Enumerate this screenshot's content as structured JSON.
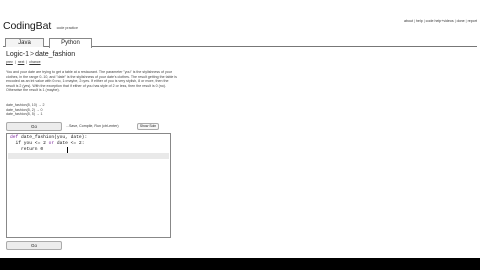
{
  "header": {
    "logo_text": "CodingBat",
    "logo_subtext": "code practice",
    "links": [
      "about",
      "help",
      "code help+videos",
      "done",
      "report"
    ]
  },
  "tabs": [
    {
      "label": "Java",
      "selected": false
    },
    {
      "label": "Python",
      "selected": true
    }
  ],
  "problem": {
    "category": "Logic-1",
    "separator": ">",
    "name": "date_fashion",
    "links": [
      "prev",
      "next",
      "chance"
    ],
    "description": "You and your date are trying to get a table at a restaurant. The parameter \"you\" is the stylishness of your clothes, in the range 0..10, and \"date\" is the stylishness of your date's clothes. The result getting the table is encoded as an int value with 0=no, 1=maybe, 2=yes. If either of you is very stylish, 8 or more, then the result is 2 (yes). With the exception that if either of you has style of 2 or less, then the result is 0 (no). Otherwise the result is 1 (maybe).",
    "examples": [
      "date_fashion(5, 10) → 2",
      "date_fashion(5, 2) → 0",
      "date_fashion(5, 5) → 1"
    ]
  },
  "controls": {
    "go_label": "Go",
    "hint_text": "...Save, Compile, Run (ctrl-enter)",
    "show_solution_label": "Show Soln"
  },
  "code": {
    "line1_kw": "def",
    "line1_rest": " date_fashion(you, date):",
    "line2_pre": "  if you <= 2 ",
    "line2_kw": "or",
    "line2_post": " date <= 2:",
    "line3": "    return 0"
  },
  "colors": {
    "keyword": "#7a1f9c",
    "background": "#ffffff",
    "letterbox": "#000000"
  }
}
